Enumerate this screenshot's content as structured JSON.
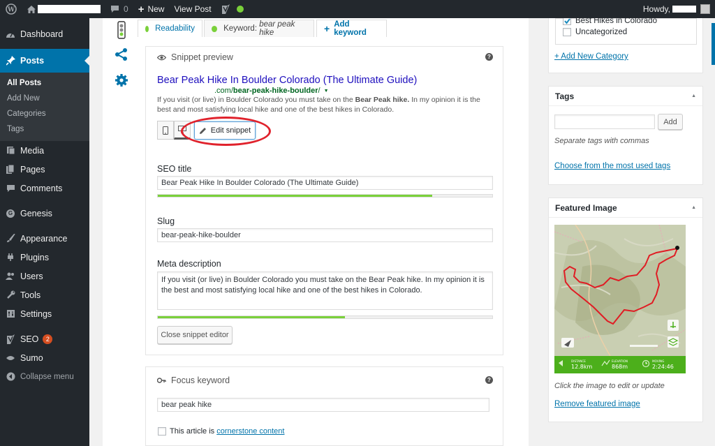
{
  "admin_bar": {
    "comment_count": "0",
    "new_label": "New",
    "view_post_label": "View Post",
    "howdy_label": "Howdy,"
  },
  "sidebar": {
    "items": [
      {
        "label": "Dashboard",
        "icon": "dashboard-icon"
      },
      {
        "label": "Posts",
        "icon": "pin-icon"
      },
      {
        "label": "Media",
        "icon": "media-icon"
      },
      {
        "label": "Pages",
        "icon": "pages-icon"
      },
      {
        "label": "Comments",
        "icon": "comments-icon"
      },
      {
        "label": "Genesis",
        "icon": "genesis-icon"
      },
      {
        "label": "Appearance",
        "icon": "brush-icon"
      },
      {
        "label": "Plugins",
        "icon": "plug-icon"
      },
      {
        "label": "Users",
        "icon": "users-icon"
      },
      {
        "label": "Tools",
        "icon": "wrench-icon"
      },
      {
        "label": "Settings",
        "icon": "settings-icon"
      },
      {
        "label": "SEO",
        "icon": "yoast-icon",
        "badge": "2"
      },
      {
        "label": "Sumo",
        "icon": "sumo-icon"
      },
      {
        "label": "Collapse menu",
        "icon": "collapse-icon"
      }
    ],
    "posts_submenu": [
      "All Posts",
      "Add New",
      "Categories",
      "Tags"
    ]
  },
  "yoast": {
    "tabs": {
      "readability": "Readability",
      "keyword_prefix": "Keyword: ",
      "keyword_value": "bear peak hike",
      "add_keyword": "Add keyword"
    },
    "snippet": {
      "heading": "Snippet preview",
      "title": "Bear Peak Hike In Boulder Colorado (The Ultimate Guide)",
      "url_domain": ".com/",
      "url_slug": "bear-peak-hike-boulder",
      "url_suffix": "/",
      "desc_before": "If you visit (or live) in Boulder Colorado you must take on the ",
      "desc_bold": "Bear Peak hike.",
      "desc_after": " In my opinion it is the best and most satisfying local hike and one of the best hikes in Colorado.",
      "edit_button": "Edit snippet"
    },
    "editor": {
      "seo_title_label": "SEO title",
      "seo_title_value": "Bear Peak Hike In Boulder Colorado (The Ultimate Guide)",
      "seo_title_progress": 0.82,
      "slug_label": "Slug",
      "slug_value": "bear-peak-hike-boulder",
      "meta_label": "Meta description",
      "meta_value": "If you visit (or live) in Boulder Colorado you must take on the Bear Peak hike. In my opinion it is the best and most satisfying local hike and one of the best hikes in Colorado.",
      "meta_progress": 0.56,
      "close_button": "Close snippet editor"
    },
    "focus": {
      "heading": "Focus keyword",
      "value": "bear peak hike",
      "cornerstone_prefix": "This article is ",
      "cornerstone_link": "cornerstone content"
    }
  },
  "categories": {
    "items": [
      {
        "label": "Best Hikes in Colorado",
        "checked": true
      },
      {
        "label": "Uncategorized",
        "checked": false
      }
    ],
    "add_new": "+ Add New Category"
  },
  "tags": {
    "title": "Tags",
    "add_button": "Add",
    "hint": "Separate tags with commas",
    "choose_link": "Choose from the most used tags"
  },
  "featured": {
    "title": "Featured Image",
    "map_stats": [
      {
        "label": "DISTANCE",
        "value": "12.8km"
      },
      {
        "label": "ELEVATION",
        "value": "868m"
      },
      {
        "label": "MOVING",
        "value": "2:24:46"
      }
    ],
    "hint": "Click the image to edit or update",
    "remove_link": "Remove featured image"
  },
  "colors": {
    "accent": "#0073aa",
    "green": "#7ad03a",
    "annotation_red": "#e0222c",
    "map_stats_bar": "#4caf1b"
  }
}
